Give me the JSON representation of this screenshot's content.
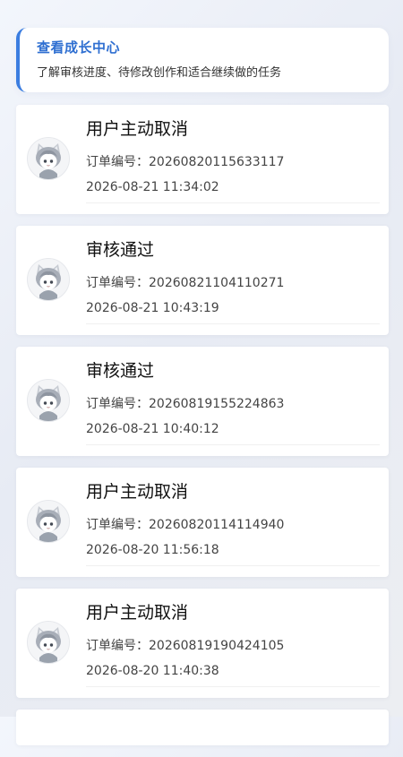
{
  "banner": {
    "title": "查看成长中心",
    "subtitle": "了解审核进度、待修改创作和适合继续做的任务",
    "accent_color": "#3b7de0"
  },
  "orders": [
    {
      "status": "用户主动取消",
      "order_label": "订单编号：",
      "order_no": "20260820115633117",
      "time": "2026-08-21 11:34:02",
      "avatar_icon": "cat-girl-avatar-icon"
    },
    {
      "status": "审核通过",
      "order_label": "订单编号：",
      "order_no": "20260821104110271",
      "time": "2026-08-21 10:43:19",
      "avatar_icon": "cat-girl-avatar-icon"
    },
    {
      "status": "审核通过",
      "order_label": "订单编号：",
      "order_no": "20260819155224863",
      "time": "2026-08-21 10:40:12",
      "avatar_icon": "cat-girl-avatar-icon"
    },
    {
      "status": "用户主动取消",
      "order_label": "订单编号：",
      "order_no": "20260820114114940",
      "time": "2026-08-20 11:56:18",
      "avatar_icon": "cat-girl-avatar-icon"
    },
    {
      "status": "用户主动取消",
      "order_label": "订单编号：",
      "order_no": "20260819190424105",
      "time": "2026-08-20 11:40:38",
      "avatar_icon": "cat-girl-avatar-icon"
    }
  ]
}
